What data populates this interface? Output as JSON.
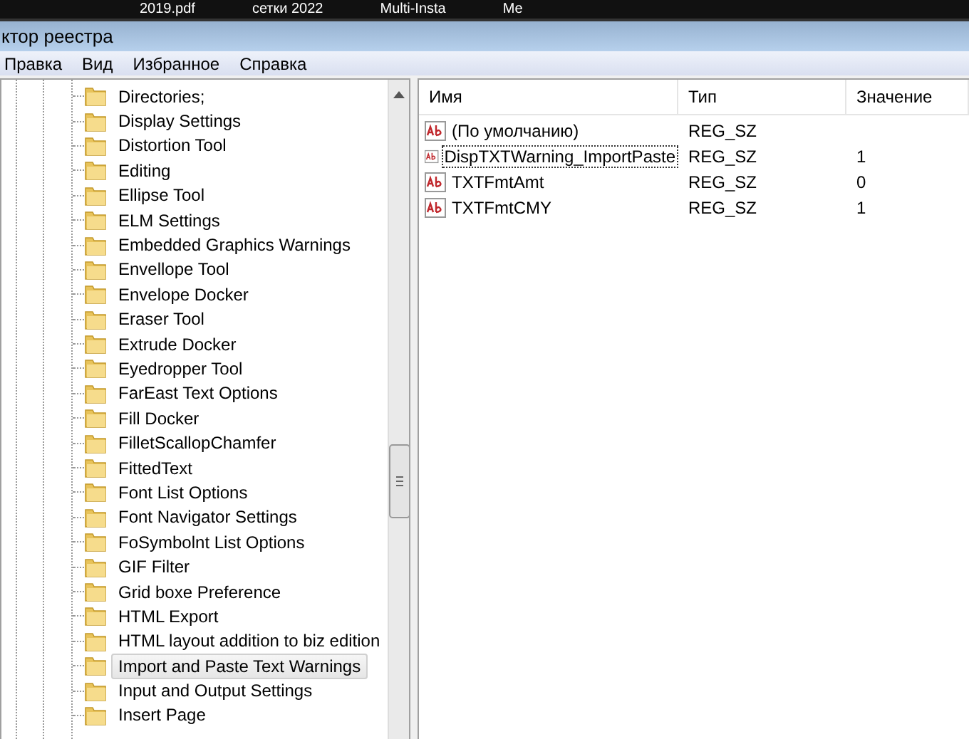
{
  "taskbar": {
    "items": [
      "2019.pdf",
      "сетки 2022",
      "Multi-Insta",
      "Me"
    ]
  },
  "window": {
    "title": "ктор реестра"
  },
  "menu": [
    "Правка",
    "Вид",
    "Избранное",
    "Справка"
  ],
  "tree": {
    "items": [
      {
        "label": "Directories;",
        "selected": false
      },
      {
        "label": "Display Settings",
        "selected": false
      },
      {
        "label": "Distortion Tool",
        "selected": false
      },
      {
        "label": "Editing",
        "selected": false
      },
      {
        "label": "Ellipse Tool",
        "selected": false
      },
      {
        "label": "ELM Settings",
        "selected": false
      },
      {
        "label": "Embedded Graphics Warnings",
        "selected": false
      },
      {
        "label": "Envellope Tool",
        "selected": false
      },
      {
        "label": "Envelope Docker",
        "selected": false
      },
      {
        "label": "Eraser Tool",
        "selected": false
      },
      {
        "label": "Extrude Docker",
        "selected": false
      },
      {
        "label": "Eyedropper Tool",
        "selected": false
      },
      {
        "label": "FarEast Text Options",
        "selected": false
      },
      {
        "label": "Fill Docker",
        "selected": false
      },
      {
        "label": "FilletScallopChamfer",
        "selected": false
      },
      {
        "label": "FittedText",
        "selected": false
      },
      {
        "label": "Font List Options",
        "selected": false
      },
      {
        "label": "Font Navigator Settings",
        "selected": false
      },
      {
        "label": "FoSymbolnt List Options",
        "selected": false
      },
      {
        "label": "GIF Filter",
        "selected": false
      },
      {
        "label": "Grid boxe Preference",
        "selected": false
      },
      {
        "label": "HTML Export",
        "selected": false
      },
      {
        "label": "HTML layout addition to biz edition",
        "selected": false
      },
      {
        "label": "Import and Paste Text Warnings",
        "selected": true
      },
      {
        "label": "Input and Output Settings",
        "selected": false
      },
      {
        "label": "Insert Page",
        "selected": false
      }
    ]
  },
  "values": {
    "columns": [
      "Имя",
      "Тип",
      "Значение"
    ],
    "rows": [
      {
        "name": "(По умолчанию)",
        "type": "REG_SZ",
        "focused": false
      },
      {
        "name": "DispTXTWarning_ImportPaste",
        "type": "REG_SZ",
        "data": "1",
        "focused": true
      },
      {
        "name": "TXTFmtAmt",
        "type": "REG_SZ",
        "data": "0",
        "focused": false
      },
      {
        "name": "TXTFmtCMY",
        "type": "REG_SZ",
        "data": "1",
        "focused": false
      }
    ]
  }
}
